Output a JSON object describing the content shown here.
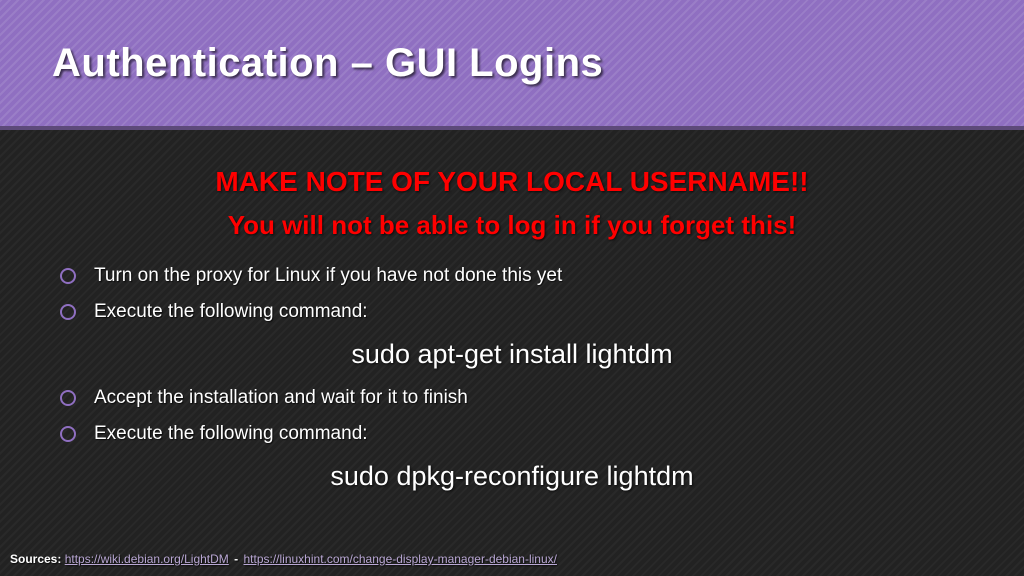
{
  "header": {
    "title": "Authentication – GUI Logins"
  },
  "warnings": {
    "line1": "MAKE NOTE OF YOUR LOCAL USERNAME!!",
    "line2": "You will not be able to log in if you forget this!"
  },
  "steps": {
    "item1": "Turn on the proxy for Linux if you have not done this yet",
    "item2": "Execute the following command:",
    "cmd1": "sudo apt-get install lightdm",
    "item3": "Accept the installation and wait for it to finish",
    "item4": "Execute the following command:",
    "cmd2": "sudo dpkg-reconfigure lightdm"
  },
  "sources": {
    "label": "Sources:",
    "link1": "https://wiki.debian.org/LightDM",
    "dash": "-",
    "link2": "https://linuxhint.com/change-display-manager-debian-linux/"
  }
}
